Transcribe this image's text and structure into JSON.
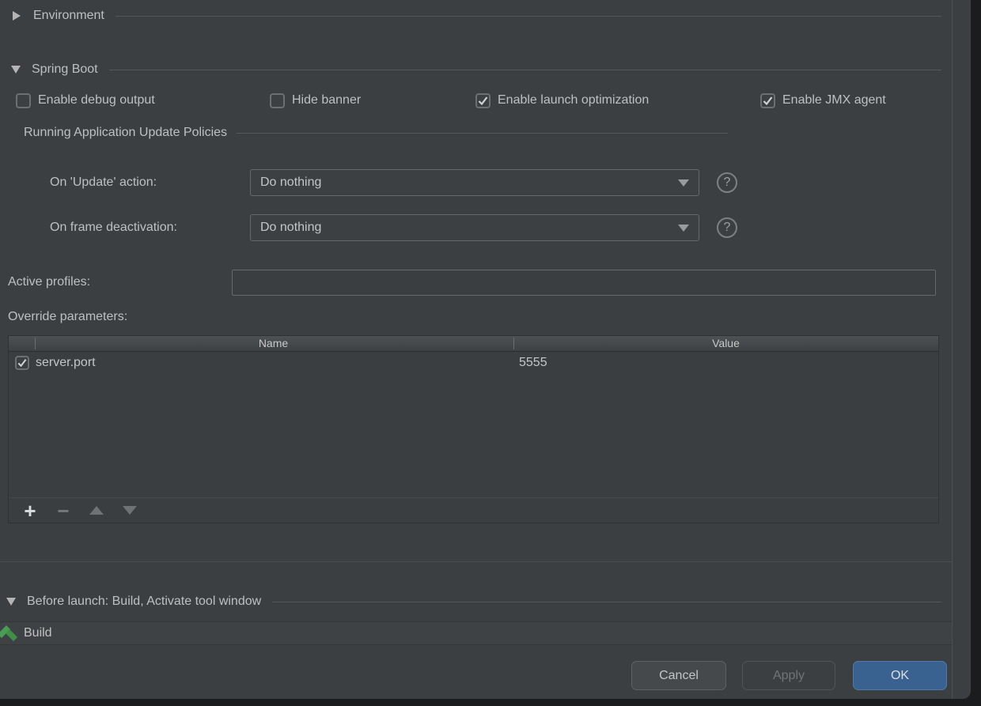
{
  "sections": {
    "environment": {
      "label": "Environment",
      "expanded": false
    },
    "spring_boot": {
      "label": "Spring Boot",
      "expanded": true,
      "checkboxes": [
        {
          "label": "Enable debug output",
          "checked": false
        },
        {
          "label": "Hide banner",
          "checked": false
        },
        {
          "label": "Enable launch optimization",
          "checked": true
        },
        {
          "label": "Enable JMX agent",
          "checked": true
        }
      ],
      "update_policies": {
        "title": "Running Application Update Policies",
        "rows": [
          {
            "label": "On 'Update' action:",
            "value": "Do nothing"
          },
          {
            "label": "On frame deactivation:",
            "value": "Do nothing"
          }
        ],
        "help_glyph": "?"
      },
      "active_profiles": {
        "label": "Active profiles:",
        "value": ""
      },
      "override_parameters": {
        "label": "Override parameters:",
        "columns": [
          "Name",
          "Value"
        ],
        "rows": [
          {
            "enabled": true,
            "name": "server.port",
            "value": "5555"
          }
        ],
        "toolbar": {
          "add_glyph": "+",
          "remove_glyph": "−"
        }
      }
    },
    "before_launch": {
      "label": "Before launch: Build, Activate tool window",
      "expanded": true,
      "tasks": [
        {
          "icon": "build-hammer-icon",
          "label": "Build"
        }
      ]
    }
  },
  "footer": {
    "cancel_label": "Cancel",
    "apply_label": "Apply",
    "ok_label": "OK",
    "apply_enabled": false
  },
  "colors": {
    "dialog_bg": "#3c3f41",
    "accent_blue": "#3a6290",
    "build_icon_green": "#499c54",
    "text": "#bdc0c2"
  }
}
